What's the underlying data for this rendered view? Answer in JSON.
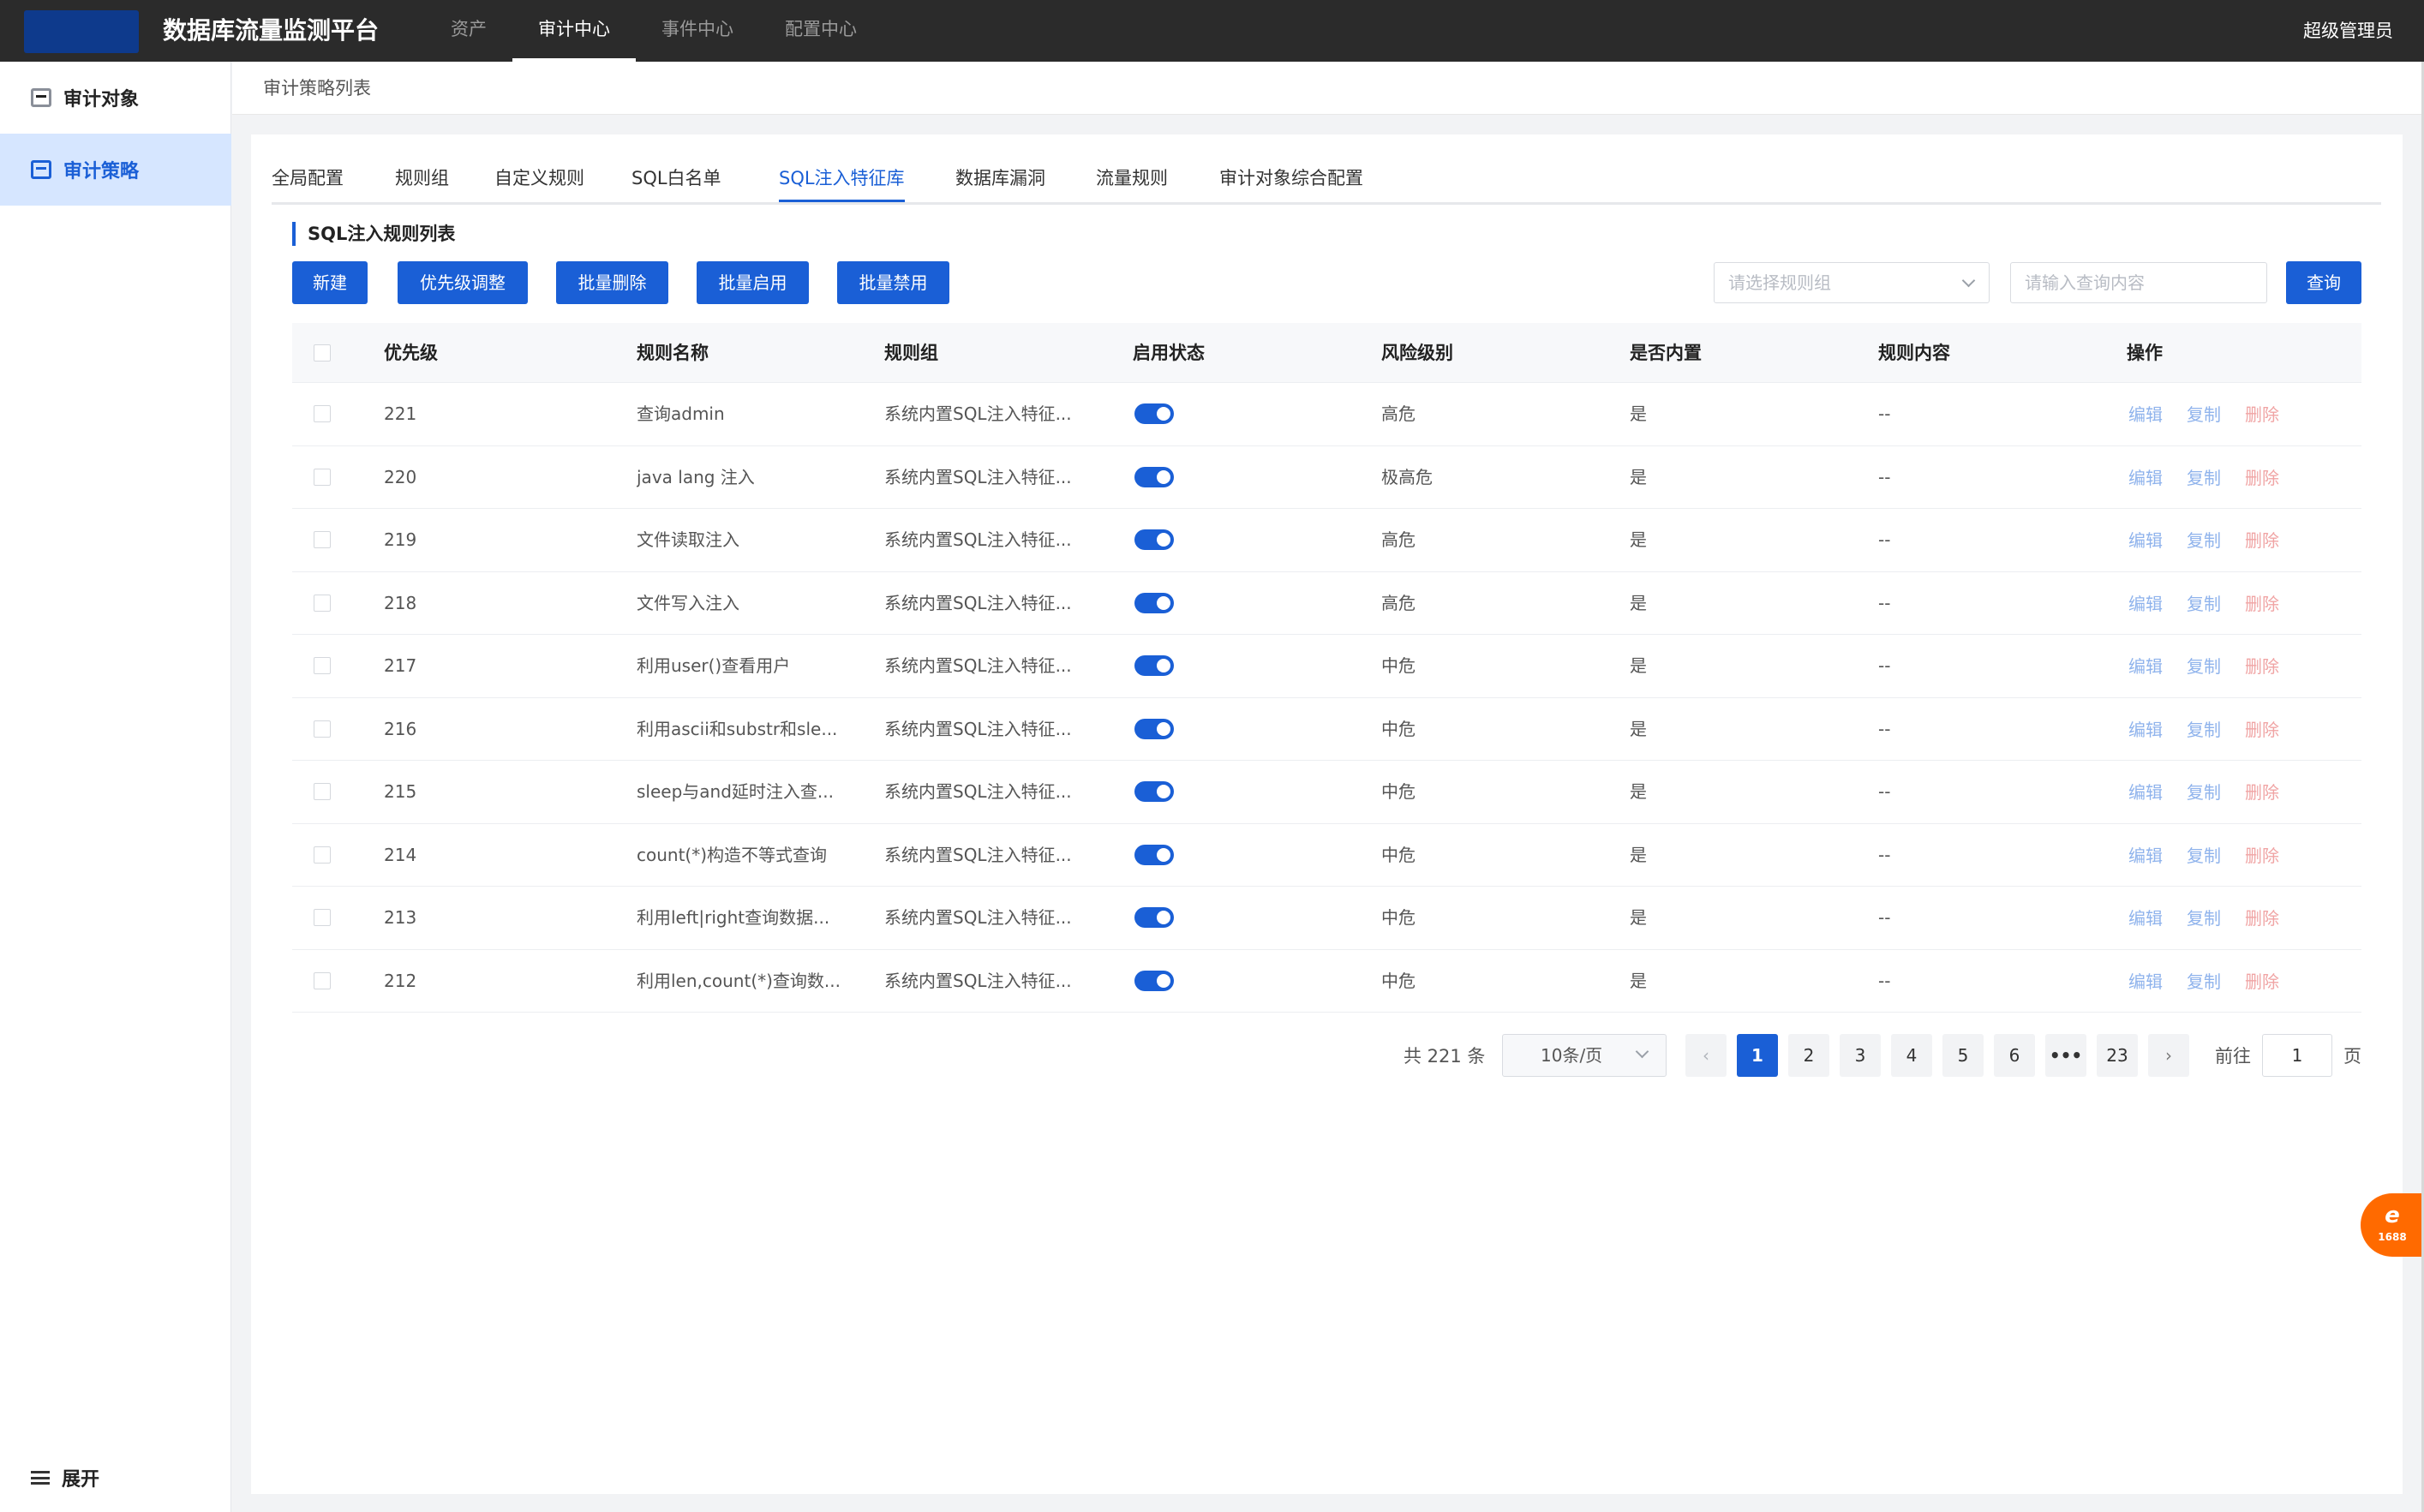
{
  "app": {
    "title": "数据库流量监测平台",
    "user": "超级管理员"
  },
  "top_nav": [
    "资产",
    "审计中心",
    "事件中心",
    "配置中心"
  ],
  "sidebar": {
    "items": [
      {
        "label": "审计对象",
        "icon": "box-icon"
      },
      {
        "label": "审计策略",
        "icon": "box-icon"
      }
    ],
    "footer_label": "展开"
  },
  "breadcrumb": "审计策略列表",
  "tabs": [
    "全局配置",
    "规则组",
    "自定义规则",
    "SQL白名单",
    "SQL注入特征库",
    "数据库漏洞",
    "流量规则",
    "审计对象综合配置"
  ],
  "section_title": "SQL注入规则列表",
  "toolbar": {
    "buttons": [
      "新建",
      "优先级调整",
      "批量删除",
      "批量启用",
      "批量禁用"
    ],
    "group_placeholder": "请选择规则组",
    "search_placeholder": "请输入查询内容",
    "query_label": "查询"
  },
  "table": {
    "headers": [
      "优先级",
      "规则名称",
      "规则组",
      "启用状态",
      "风险级别",
      "是否内置",
      "规则内容",
      "操作"
    ],
    "rows": [
      {
        "priority": "221",
        "name": "查询admin",
        "group": "系统内置SQL注入特征...",
        "risk": "高危",
        "builtin": "是",
        "content": "--"
      },
      {
        "priority": "220",
        "name": "java lang 注入",
        "group": "系统内置SQL注入特征...",
        "risk": "极高危",
        "builtin": "是",
        "content": "--"
      },
      {
        "priority": "219",
        "name": "文件读取注入",
        "group": "系统内置SQL注入特征...",
        "risk": "高危",
        "builtin": "是",
        "content": "--"
      },
      {
        "priority": "218",
        "name": "文件写入注入",
        "group": "系统内置SQL注入特征...",
        "risk": "高危",
        "builtin": "是",
        "content": "--"
      },
      {
        "priority": "217",
        "name": "利用user()查看用户",
        "group": "系统内置SQL注入特征...",
        "risk": "中危",
        "builtin": "是",
        "content": "--"
      },
      {
        "priority": "216",
        "name": "利用ascii和substr和sle...",
        "group": "系统内置SQL注入特征...",
        "risk": "中危",
        "builtin": "是",
        "content": "--"
      },
      {
        "priority": "215",
        "name": "sleep与and延时注入查...",
        "group": "系统内置SQL注入特征...",
        "risk": "中危",
        "builtin": "是",
        "content": "--"
      },
      {
        "priority": "214",
        "name": "count(*)构造不等式查询",
        "group": "系统内置SQL注入特征...",
        "risk": "中危",
        "builtin": "是",
        "content": "--"
      },
      {
        "priority": "213",
        "name": "利用left|right查询数据...",
        "group": "系统内置SQL注入特征...",
        "risk": "中危",
        "builtin": "是",
        "content": "--"
      },
      {
        "priority": "212",
        "name": "利用len,count(*)查询数...",
        "group": "系统内置SQL注入特征...",
        "risk": "中危",
        "builtin": "是",
        "content": "--"
      }
    ],
    "ops": {
      "edit": "编辑",
      "copy": "复制",
      "delete": "删除"
    }
  },
  "pagination": {
    "total": "共 221 条",
    "page_size": "10条/页",
    "pages": [
      "1",
      "2",
      "3",
      "4",
      "5",
      "6",
      "•••",
      "23"
    ],
    "current": "1",
    "goto_label": "前往",
    "goto_value": "1",
    "page_suffix": "页"
  },
  "float_badge": {
    "main": "e",
    "sub": "1688"
  },
  "colors": {
    "accent": "#1a5fd6",
    "topbar": "#2b2b2b",
    "sidebar_active": "#d6e6ff",
    "badge": "#ff6a00"
  }
}
